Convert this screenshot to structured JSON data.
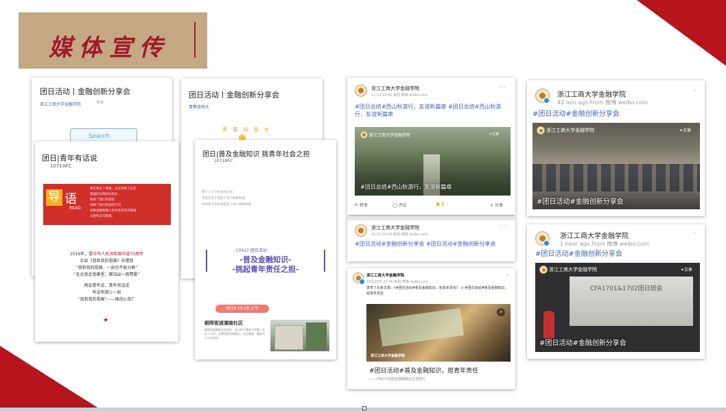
{
  "title": "媒体宣传",
  "card1": {
    "title": "团日活动丨金融创新分享会",
    "source": "浙江工商大学金融学院",
    "date": "昨天",
    "search_label": "Search"
  },
  "card2": {
    "title": "团日|青年有话说",
    "code": "1071AFC",
    "banner_big": "导",
    "banner_big2": "语",
    "banner_small": "READ",
    "banner_text": "那年我去了黄桷，日出带来了光芒\n祖国的光辉好似阳光\n照亮了我们的前程\n指明了我们前进的方向\n青春金融致敬人民共享会走向富裕\n从胜利走向辉煌。",
    "poem_l1a": "2019年，是",
    "poem_l1b": "中华人民共和国华诞70周年",
    "poem_l2": "正如《我和我的祖国》中唱到",
    "poem_l3": "“我和我的祖国，一刻也不能分割”",
    "poem_l4": "“无论我走到哪里，都流出一首赞歌”",
    "poem_l5": "两会青年说，青年有话说",
    "poem_l6": "有没有那么一刻",
    "poem_l7": "“我和我的祖国”——振动心弦？",
    "star": "★"
  },
  "card3": {
    "title": "团日活动丨金融创新分享会",
    "source": "青春浙商大",
    "balloon": "青 春 向 昌 大"
  },
  "card4": {
    "title": "团日|普及金融知识 挑青年社会之担",
    "code": "1071AFC",
    "intro": "每个人之于社会的价值，\n不仅仅在于创造了多少物质财富，\n同时在于为社会担负了多少精神财富。",
    "tag_line": "CFA17    团日活动",
    "headline1": "-普及金融知识-",
    "headline2": "-挑起青年责任之担-",
    "date_label": "2018.10.28 上午",
    "location": "朝晖街道潮南社区",
    "desc": "朝晖街道潮南社区地处，总占地下辖若干街巷，社区人口约，共建设图书馆数所，社区数据，服务中心公共场所。"
  },
  "weibo1": {
    "name": "浙江工商大学金融学院",
    "meta": "11-19 22:42 来自 微博 weibo.com",
    "tags": "#团日总结#西山秋游行，友谊新篇章 #团日总结#西山秋游行，友谊新篇章",
    "photo_name": "浙江工商大学金融学院",
    "photo_badge": "✦文章",
    "photo_caption": "#团日总结#西山秋游行，友谊新篇章",
    "action_repost": "转发",
    "action_comment": "评论",
    "action_like": "1",
    "action_share": "分享",
    "more": "···"
  },
  "weibo2": {
    "name": "浙江工商大学金融学院",
    "meta": "11-03 20:26 来自 微博 weibo.com",
    "tags": "#团日活动#金融创新分享会 #团日活动#金融创新分享会",
    "more": "···"
  },
  "weibo3": {
    "name": "浙江工商大学金融学院",
    "meta": "10月28日 23:46 来自 微博 weibo.com",
    "text": "发布了头条文章：《#团日活动#普及金融知识，担青年责任》 ⊙ #团日活动#普及金融知识，担青年责任",
    "photo_logo": "浙江工商大学金融学院",
    "caption": "#团日活动#普及金融知识，担青年责任",
    "sub": "——CFA1701团支部赠南社区志愿行"
  },
  "weibo4": {
    "name": "浙江工商大学金融学院",
    "meta": "42 min ago  From 微博 weibo.com",
    "tags": "#团日活动#金融创新分享会",
    "photo_name": "浙江工商大学金融学院",
    "photo_badge": "✦文章",
    "photo_caption": "#团日活动#金融创新分享会"
  },
  "weibo5": {
    "name": "浙江工商大学金融学院",
    "meta": "1 hour ago  From 微博 weibo.com",
    "tags": "#团日活动#金融创新分享会",
    "photo_name": "浙江工商大学金融学院",
    "photo_badge": "✦文章",
    "screen_text": "CFA1701&1702团日班会",
    "photo_caption": "#团日活动#金融创新分享会"
  },
  "colors": {
    "accent_red": "#b5151b",
    "title_bg": "#c4a883",
    "link_blue": "#3a67b5"
  }
}
